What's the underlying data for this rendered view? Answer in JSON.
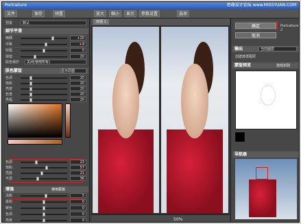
{
  "window": {
    "title": "Portraiture",
    "watermark": "思缘设计论坛 www.MISSYUAN.COM"
  },
  "toolbar": {
    "items": [
      "文件",
      "保存",
      "预置",
      "放大",
      "缩小",
      "显示",
      "参数设置",
      "选项"
    ]
  },
  "left": {
    "preset_label": "预置",
    "preset_value": "默认",
    "section1": "细节平滑",
    "rows1": [
      {
        "label": "精细",
        "value": "+20",
        "pos": 0.7
      },
      {
        "label": "中等",
        "value": "+4",
        "pos": 0.55
      },
      {
        "label": "较粗",
        "value": "0",
        "pos": 0.5
      },
      {
        "label": "阈值",
        "value": "20",
        "pos": 0.3
      }
    ],
    "auto_label": "肤色保护",
    "auto_value": "关闭(使用所有)",
    "section2": "肤色蒙版",
    "mask_value": "显示原图",
    "rows2": [
      {
        "label": "色调",
        "value": "20",
        "pos": 0.2
      },
      {
        "label": "饱和",
        "value": "20",
        "pos": 0.2
      },
      {
        "label": "亮度",
        "value": "20",
        "pos": 0.2
      },
      {
        "label": "色宽",
        "value": "20",
        "pos": 0.2
      },
      {
        "label": "亮幅",
        "value": "20",
        "pos": 0.2
      }
    ],
    "rows3": [
      {
        "label": "色调",
        "value": "23",
        "pos": 0.33
      },
      {
        "label": "饱和",
        "value": "57",
        "pos": 0.57
      },
      {
        "label": "亮度",
        "value": "21",
        "pos": 0.45
      },
      {
        "label": "不透",
        "value": "36",
        "pos": 0.36
      }
    ],
    "section3": "增强",
    "use_mask": "使用蒙版",
    "rows4": [
      {
        "label": "清晰",
        "value": "5",
        "pos": 0.55
      },
      {
        "label": "柔和",
        "value": "0",
        "pos": 0.5
      },
      {
        "label": "暖色",
        "value": "0",
        "pos": 0.5
      },
      {
        "label": "色调",
        "value": "0",
        "pos": 0.5
      },
      {
        "label": "亮度",
        "value": "0",
        "pos": 0.5
      },
      {
        "label": "对比",
        "value": "0",
        "pos": 0.5
      }
    ]
  },
  "center": {
    "tab": "双视 1",
    "zoom": "50%"
  },
  "right": {
    "ok_label": "确定",
    "cancel_label": "取消",
    "product": "Portraiture 2",
    "output_label": "输出",
    "output_value": "当前图层",
    "create_mask": "创建遮罩图层",
    "mask_preview": "蒙版预览",
    "auto_detect": "自动识别",
    "navigator": "导航器",
    "colors": {
      "brand": "#c62828",
      "accent": "#e6e6e6"
    }
  }
}
